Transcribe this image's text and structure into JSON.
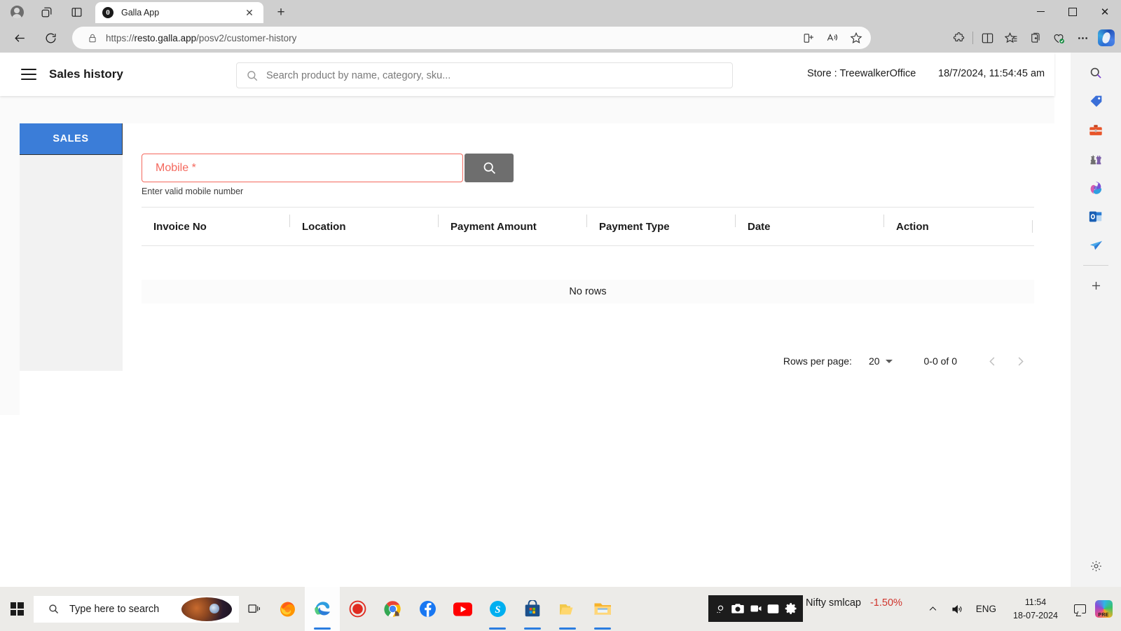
{
  "browser": {
    "tab": {
      "title": "Galla App",
      "favicon": "galla-favicon",
      "close": "✕"
    },
    "newtab": "+",
    "url_prefix": "https://",
    "url_domain": "resto.galla.app",
    "url_path": "/posv2/customer-history",
    "url_full": "https://resto.galla.app/posv2/customer-history",
    "window_controls": {
      "minimize": "—",
      "maximize": "□",
      "close": "✕"
    },
    "toolbar_icons": [
      "split-screen-add-icon",
      "read-aloud-icon",
      "favorite-star-icon",
      "extensions-icon",
      "split-screen-icon",
      "collections-star-icon",
      "add-to-collections-icon",
      "browser-essentials-icon",
      "settings-more-icon",
      "copilot-icon"
    ],
    "sidebar_icons": [
      "search-icon",
      "shopping-tag-icon",
      "tools-toolbox-icon",
      "games-chess-icon",
      "microsoft365-icon",
      "outlook-icon",
      "paper-plane-icon",
      "add-icon",
      "settings-gear-icon"
    ]
  },
  "app": {
    "menu_icon": "hamburger-menu-icon",
    "title": "Sales history",
    "search": {
      "placeholder": "Search product by name, category, sku...",
      "value": "",
      "icon": "search-icon"
    },
    "store": "Store : TreewalkerOffice",
    "datetime": "18/7/2024, 11:54:45 am"
  },
  "side_panel": {
    "tabs": [
      {
        "label": "SALES",
        "active": true
      }
    ]
  },
  "form": {
    "mobile": {
      "label": "Mobile *",
      "value": "",
      "error": true,
      "accent": "#f4685d"
    },
    "search_button_icon": "search-icon",
    "helper_text": "Enter valid mobile number"
  },
  "table": {
    "columns": [
      "Invoice No",
      "Location",
      "Payment Amount",
      "Payment Type",
      "Date",
      "Action"
    ],
    "rows": [],
    "empty_text": "No rows"
  },
  "pagination": {
    "rows_per_page_label": "Rows per page:",
    "rows_per_page_value": "20",
    "range_text": "0-0 of 0",
    "prev_icon": "chevron-left-icon",
    "next_icon": "chevron-right-icon",
    "prev_enabled": false,
    "next_enabled": false
  },
  "taskbar": {
    "start_icon": "windows-start-icon",
    "search_placeholder": "Type here to search",
    "taskview_icon": "task-view-icon",
    "apps": [
      {
        "name": "firefox",
        "active": false
      },
      {
        "name": "edge",
        "active": true
      },
      {
        "name": "screen-recorder",
        "active": false
      },
      {
        "name": "chrome",
        "active": false
      },
      {
        "name": "facebook",
        "active": false
      },
      {
        "name": "youtube",
        "active": false
      },
      {
        "name": "skype",
        "active": false
      },
      {
        "name": "microsoft-store",
        "active": false
      },
      {
        "name": "folder-yellow",
        "active": false
      },
      {
        "name": "file-explorer",
        "active": false
      }
    ],
    "recorder_tools": [
      "screenshot-icon",
      "camera-icon",
      "video-icon",
      "window-icon",
      "gear-icon"
    ],
    "ticker": {
      "name": "Nifty smlcap",
      "change": "-1.50%",
      "color": "#d0342c"
    },
    "tray": {
      "chevron_icon": "chevron-up-icon",
      "volume_icon": "volume-icon",
      "language": "ENG",
      "time": "11:54",
      "date": "18-07-2024",
      "notification_icon": "notification-icon",
      "copilot_icon": "copilot-pre-icon",
      "copilot_badge": "PRE"
    }
  }
}
